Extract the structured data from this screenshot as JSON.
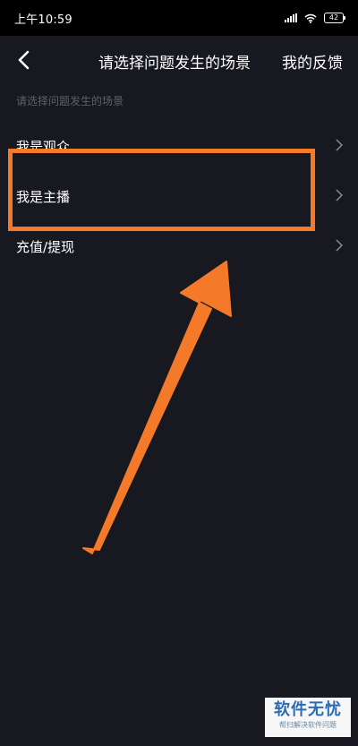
{
  "status_bar": {
    "time": "上午10:59",
    "battery": "42"
  },
  "nav": {
    "title": "请选择问题发生的场景",
    "action": "我的反馈"
  },
  "section": {
    "header": "请选择问题发生的场景"
  },
  "menu": {
    "items": [
      {
        "label": "我是观众"
      },
      {
        "label": "我是主播"
      },
      {
        "label": "充值/提现"
      }
    ]
  },
  "annotation": {
    "color": "#f47a2a"
  },
  "watermark": {
    "main": "软件无忧",
    "sub": "帮扫解决软件问题"
  },
  "icons": {
    "back": "chevron-left-icon",
    "item": "chevron-right-icon",
    "signal": "signal-icon",
    "wifi": "wifi-icon",
    "battery": "battery-icon"
  }
}
